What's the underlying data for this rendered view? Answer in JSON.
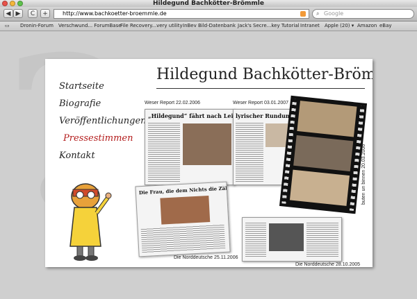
{
  "window": {
    "title": "Hildegund Bachkötter-Brömmle"
  },
  "toolbar": {
    "url": "http://www.bachkoetter-broemmle.de",
    "search_placeholder": "Google",
    "back_label": "◀",
    "forward_label": "▶",
    "reload_label": "C",
    "add_label": "+"
  },
  "bookmarks": [
    "Dronin-Forum",
    "Verschwund... ForumBase",
    "File Recovery...very utility",
    "InBev Bild-Datenbank",
    "Jack's Secre...key Tutorial",
    "Intranet",
    "Apple (20) ▾",
    "Amazon",
    "eBay"
  ],
  "site": {
    "name": "Hildegund Bachkötter-Brömmle",
    "nav": [
      "Startseite",
      "Biografie",
      "Veröffentlichungen",
      "Pressestimmen",
      "Kontakt"
    ],
    "active_nav": "Pressestimmen"
  },
  "clippings": {
    "c1": {
      "caption": "Weser Report 22.02.2006",
      "headline": "„Hildegund“ fährt nach Leipzig"
    },
    "c2": {
      "caption": "Weser Report 03.01.2007",
      "headline": "lyrischer Rundumsch"
    },
    "c3": {
      "caption": "Die Norddeutsche 25.11.2006",
      "headline": "Die Frau, die dem Nichts die Zähne zeigt"
    },
    "c4": {
      "caption": "Die Norddeutsche 28.10.2005"
    },
    "film_caption": "buten un binnen 20.03.2006"
  },
  "colors": {
    "active_nav": "#b31b1b",
    "rss": "#f29a38"
  }
}
